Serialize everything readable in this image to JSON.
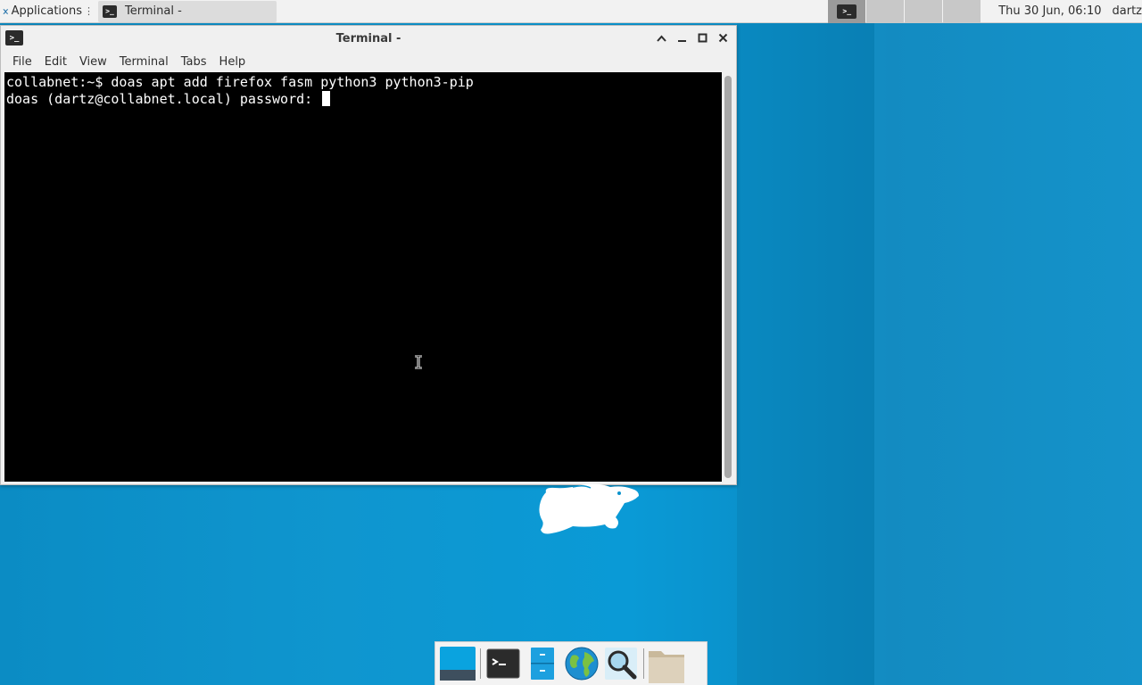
{
  "top_panel": {
    "applications_label": "Applications",
    "task_title": "Terminal -",
    "clock": "Thu 30 Jun, 06:10",
    "user": "dartz"
  },
  "window": {
    "title": "Terminal -",
    "menu": [
      "File",
      "Edit",
      "View",
      "Terminal",
      "Tabs",
      "Help"
    ]
  },
  "terminal": {
    "lines": [
      "collabnet:~$ doas apt add firefox fasm python3 python3-pip",
      "doas (dartz@collabnet.local) password: "
    ]
  },
  "dock": {
    "items": [
      "show-desktop",
      "terminal",
      "file-manager",
      "web-browser",
      "app-finder",
      "folder"
    ]
  },
  "colors": {
    "desktop": "#0a92cc",
    "terminal_bg": "#000000",
    "terminal_fg": "#ffffff",
    "panel": "#f2f2f2"
  }
}
